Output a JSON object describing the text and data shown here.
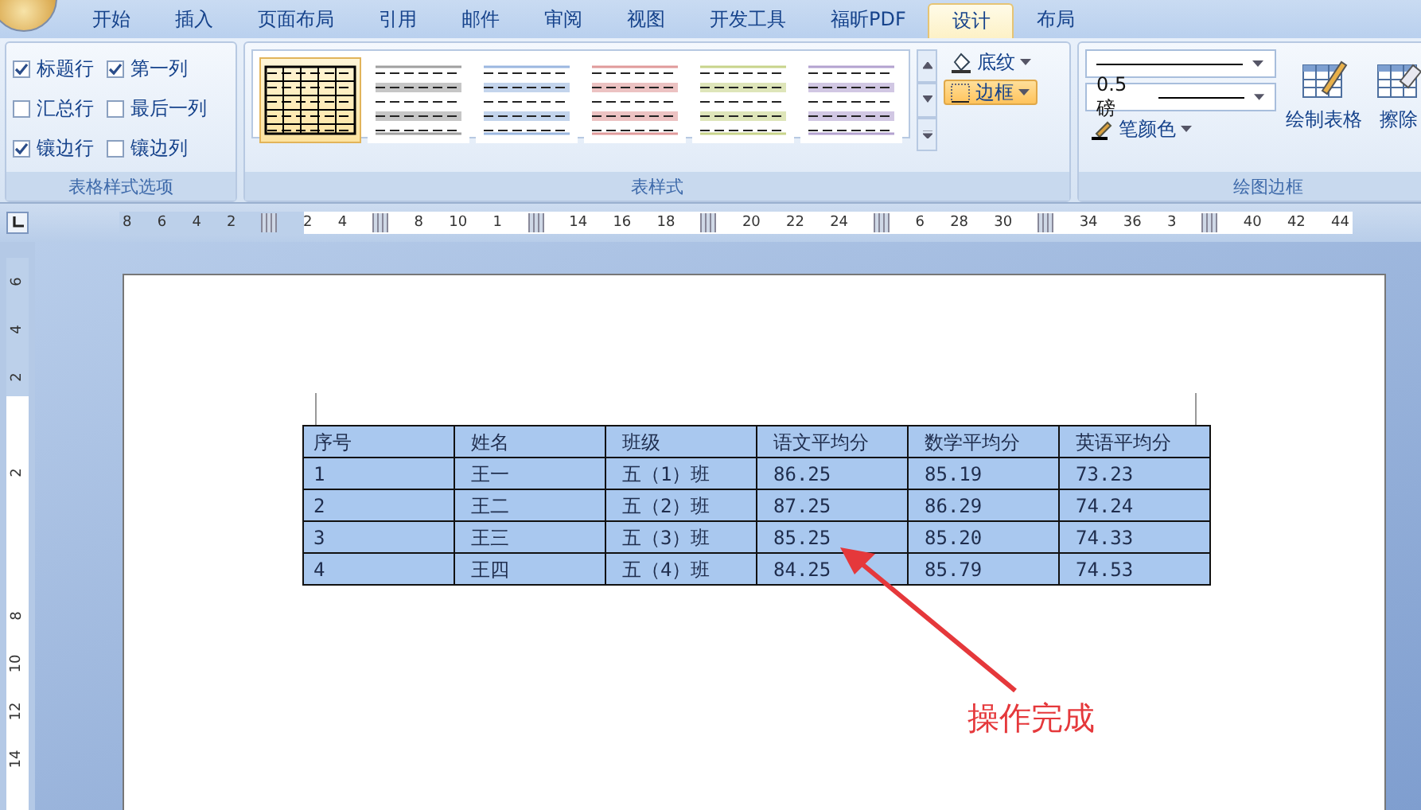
{
  "menu_tabs": [
    {
      "label": "开始",
      "selected": false
    },
    {
      "label": "插入",
      "selected": false
    },
    {
      "label": "页面布局",
      "selected": false
    },
    {
      "label": "引用",
      "selected": false
    },
    {
      "label": "邮件",
      "selected": false
    },
    {
      "label": "审阅",
      "selected": false
    },
    {
      "label": "视图",
      "selected": false
    },
    {
      "label": "开发工具",
      "selected": false
    },
    {
      "label": "福昕PDF",
      "selected": false
    },
    {
      "label": "设计",
      "selected": true
    },
    {
      "label": "布局",
      "selected": false
    }
  ],
  "style_options": {
    "title": "表格样式选项",
    "items": [
      {
        "label": "标题行",
        "checked": true
      },
      {
        "label": "第一列",
        "checked": true
      },
      {
        "label": "汇总行",
        "checked": false
      },
      {
        "label": "最后一列",
        "checked": false
      },
      {
        "label": "镶边行",
        "checked": true
      },
      {
        "label": "镶边列",
        "checked": false
      }
    ]
  },
  "table_styles": {
    "title": "表样式",
    "styles": [
      {
        "selected": true,
        "color": "#000000"
      },
      {
        "selected": false,
        "color": "#a0a0a0"
      },
      {
        "selected": false,
        "color": "#9bb7e0"
      },
      {
        "selected": false,
        "color": "#e09a9a"
      },
      {
        "selected": false,
        "color": "#c8d48a"
      },
      {
        "selected": false,
        "color": "#b3a2d0"
      }
    ],
    "buttons": [
      {
        "label": "底纹",
        "highlighted": false
      },
      {
        "label": "边框",
        "highlighted": true
      }
    ]
  },
  "draw_borders": {
    "title": "绘图边框",
    "weight": "0.5 磅",
    "pen_color": "笔颜色",
    "buttons": [
      "绘制表格",
      "擦除"
    ]
  },
  "ruler": [
    {
      "kind": "num",
      "label": "8"
    },
    {
      "kind": "num",
      "label": "6"
    },
    {
      "kind": "num",
      "label": "4"
    },
    {
      "kind": "num",
      "label": "2"
    },
    {
      "kind": "marker"
    },
    {
      "kind": "num",
      "label": "2"
    },
    {
      "kind": "num",
      "label": "4"
    },
    {
      "kind": "marker"
    },
    {
      "kind": "num",
      "label": "8"
    },
    {
      "kind": "num",
      "label": "10"
    },
    {
      "kind": "num",
      "label": "1"
    },
    {
      "kind": "marker"
    },
    {
      "kind": "num",
      "label": "14"
    },
    {
      "kind": "num",
      "label": "16"
    },
    {
      "kind": "num",
      "label": "18"
    },
    {
      "kind": "marker"
    },
    {
      "kind": "num",
      "label": "20"
    },
    {
      "kind": "num",
      "label": "22"
    },
    {
      "kind": "num",
      "label": "24"
    },
    {
      "kind": "marker"
    },
    {
      "kind": "num",
      "label": "6"
    },
    {
      "kind": "num",
      "label": "28"
    },
    {
      "kind": "num",
      "label": "30"
    },
    {
      "kind": "marker"
    },
    {
      "kind": "num",
      "label": "34"
    },
    {
      "kind": "num",
      "label": "36"
    },
    {
      "kind": "num",
      "label": "3"
    },
    {
      "kind": "marker"
    },
    {
      "kind": "num",
      "label": "40"
    },
    {
      "kind": "num",
      "label": "42"
    },
    {
      "kind": "num",
      "label": "44"
    }
  ],
  "vertical_ruler": [
    {
      "kind": "num",
      "label": "6"
    },
    {
      "kind": "num",
      "label": "4"
    },
    {
      "kind": "num",
      "label": "2"
    },
    {
      "kind": "gap"
    },
    {
      "kind": "num",
      "label": "2"
    },
    {
      "kind": "gap"
    },
    {
      "kind": "gap"
    },
    {
      "kind": "num",
      "label": "8"
    },
    {
      "kind": "num",
      "label": "10"
    },
    {
      "kind": "num",
      "label": "12"
    },
    {
      "kind": "num",
      "label": "14"
    }
  ],
  "table": {
    "columns": [
      "序号",
      "姓名",
      "班级",
      "语文平均分",
      "数学平均分",
      "英语平均分"
    ],
    "rows": [
      [
        "1",
        "王一",
        "五（1）班",
        "86.25",
        "85.19",
        "73.23"
      ],
      [
        "2",
        "王二",
        "五（2）班",
        "87.25",
        "86.29",
        "74.24"
      ],
      [
        "3",
        "王三",
        "五（3）班",
        "85.25",
        "85.20",
        "74.33"
      ],
      [
        "4",
        "王四",
        "五（4）班",
        "84.25",
        "85.79",
        "74.53"
      ]
    ]
  },
  "annotation": "操作完成"
}
